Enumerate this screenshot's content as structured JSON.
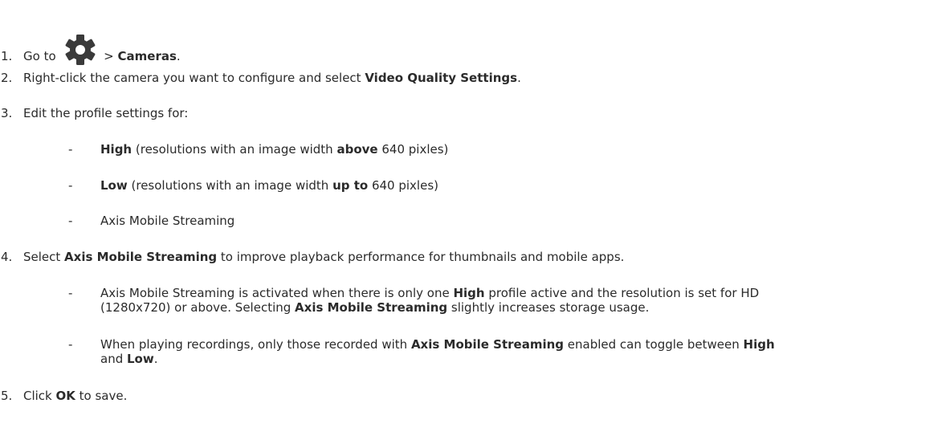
{
  "steps": [
    {
      "num": "1.",
      "p1": "Go to ",
      "p2": " > ",
      "b1": "Cameras",
      "p3": ".",
      "icon": "gear-icon"
    },
    {
      "num": "2.",
      "p1": "Right-click the camera you want to configure and select ",
      "b1": "Video Quality Settings",
      "p2": "."
    },
    {
      "num": "3.",
      "p1": "Edit the profile settings for:"
    },
    {
      "num": "4.",
      "p1": "Select ",
      "b1": "Axis Mobile Streaming",
      "p2": " to improve playback performance for thumbnails and mobile apps."
    },
    {
      "num": "5.",
      "p1": "Click ",
      "b1": "OK",
      "p2": " to save."
    }
  ],
  "profiles": [
    {
      "b1": "High",
      "p1": " (resolutions with an image width ",
      "b2": "above",
      "p2": " 640 pixles)"
    },
    {
      "b1": "Low",
      "p1": " (resolutions with an image width ",
      "b2": "up to",
      "p2": " 640 pixles)"
    },
    {
      "p1": "Axis Mobile Streaming"
    }
  ],
  "notes": [
    {
      "p1": "Axis Mobile Streaming is activated when there is only one ",
      "b1": "High",
      "p2": " profile active and the resolution is set for HD",
      "p3": "(1280x720) or above. Selecting ",
      "b2": "Axis Mobile Streaming",
      "p4": " slightly increases storage usage."
    },
    {
      "p1": "When playing recordings, only those recorded with ",
      "b1": "Axis Mobile Streaming",
      "p2": " enabled can toggle between ",
      "b2": "High",
      "p3": "and ",
      "b4": "Low",
      "p4": "."
    }
  ],
  "dash": "-",
  "colors": {
    "text": "#2b2b2b",
    "icon": "#3a3a3a"
  }
}
